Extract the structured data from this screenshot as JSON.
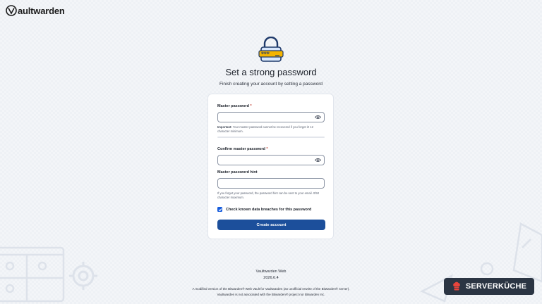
{
  "brand": {
    "logo_text": "aultwarden",
    "logo_icon": "vaultwarden-v-icon"
  },
  "page": {
    "title": "Set a strong password",
    "subtitle": "Finish creating your account by setting a password"
  },
  "form": {
    "master_password_label": "Master password",
    "required_mark": "*",
    "master_password_value": "",
    "important_label": "Important:",
    "important_text": " Your master password cannot be recovered if you forget it! 12 character minimum.",
    "strength_fraction": 0,
    "confirm_label": "Confirm master password",
    "confirm_value": "",
    "hint_label": "Master password hint",
    "hint_value": "",
    "hint_help": "If you forget your password, the password hint can be sent to your email. 0/50 character maximum.",
    "breach_label": "Check known data breaches for this password",
    "breach_checked": true,
    "submit_label": "Create account"
  },
  "footer": {
    "app_name": "Vaultwarden Web",
    "version": "2026.6.4",
    "disclaimer_1": "A modified version of the Bitwarden® Web Vault for Vaultwarden (an unofficial rewrite of the Bitwarden® server).",
    "disclaimer_2": "Vaultwarden is not associated with the Bitwarden® project nor Bitwarden Inc."
  },
  "badge": {
    "text": "SERVERKÜCHE",
    "icon": "chef-hat-icon"
  },
  "colors": {
    "accent": "#175ddc",
    "button": "#1c4f9b",
    "badge_bg": "#2b3543",
    "required": "#c0392b"
  }
}
